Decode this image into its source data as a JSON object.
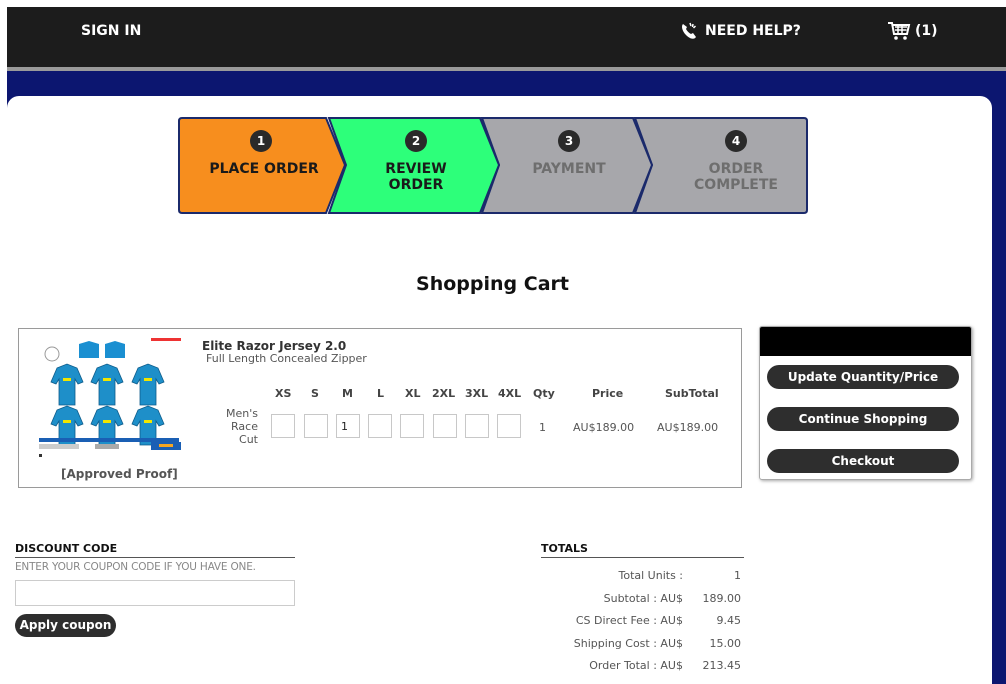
{
  "header": {
    "sign_in": "SIGN IN",
    "need_help": "NEED HELP?",
    "cart_count": "(1)"
  },
  "steps": [
    {
      "num": "1",
      "line1": "PLACE ORDER",
      "line2": "",
      "color": "#f78e1e",
      "text_color": "#1a1a1a"
    },
    {
      "num": "2",
      "line1": "REVIEW",
      "line2": "ORDER",
      "color": "#2dff7a",
      "text_color": "#1a1a1a"
    },
    {
      "num": "3",
      "line1": "PAYMENT",
      "line2": "",
      "color": "#a7a7ab",
      "text_color": "#6e6e6e"
    },
    {
      "num": "4",
      "line1": "ORDER",
      "line2": "COMPLETE",
      "color": "#a7a7ab",
      "text_color": "#6e6e6e"
    }
  ],
  "cart": {
    "title": "Shopping Cart",
    "product": {
      "name": "Elite Razor Jersey 2.0",
      "description": "Full Length Concealed Zipper",
      "approved": "[Approved Proof]",
      "cut_line1": "Men's",
      "cut_line2": "Race",
      "cut_line3": "Cut",
      "sizes": [
        "XS",
        "S",
        "M",
        "L",
        "XL",
        "2XL",
        "3XL",
        "4XL"
      ],
      "size_values": [
        "",
        "",
        "1",
        "",
        "",
        "",
        "",
        ""
      ],
      "qty_header": "Qty",
      "price_header": "Price",
      "subtotal_header": "SubTotal",
      "qty": "1",
      "price": "AU$189.00",
      "subtotal": "AU$189.00"
    }
  },
  "actions": {
    "update": "Update Quantity/Price",
    "continue": "Continue Shopping",
    "checkout": "Checkout"
  },
  "discount": {
    "title": "DISCOUNT CODE",
    "hint": "ENTER YOUR COUPON CODE IF YOU HAVE ONE.",
    "value": "",
    "button": "Apply coupon"
  },
  "totals": {
    "title": "TOTALS",
    "rows": [
      {
        "label": "Total Units :",
        "value": "1"
      },
      {
        "label": "Subtotal : AU$",
        "value": "189.00"
      },
      {
        "label": "CS Direct Fee : AU$",
        "value": "9.45"
      },
      {
        "label": "Shipping Cost : AU$",
        "value": "15.00"
      },
      {
        "label": "Order Total : AU$",
        "value": "213.45"
      }
    ]
  }
}
